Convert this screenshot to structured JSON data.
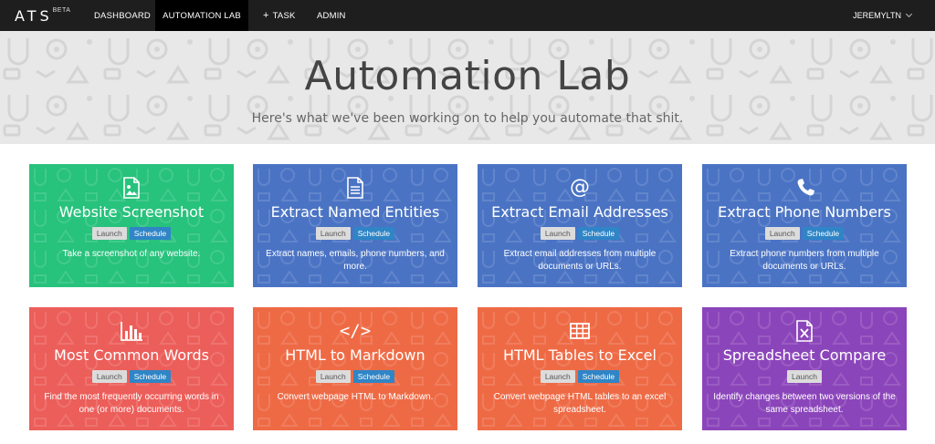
{
  "nav": {
    "brand": "ATS",
    "brand_sup": "BETA",
    "items": [
      {
        "label": "DASHBOARD",
        "active": false
      },
      {
        "label": "AUTOMATION LAB",
        "active": true
      },
      {
        "label": "TASK",
        "active": false
      },
      {
        "label": "ADMIN",
        "active": false
      }
    ],
    "task_plus": "+",
    "user": "JEREMYLTN"
  },
  "hero": {
    "title": "Automation Lab",
    "subtitle": "Here's what we've been working on to help you automate that shit."
  },
  "buttons": {
    "launch": "Launch",
    "schedule": "Schedule"
  },
  "cards": [
    {
      "title": "Website Screenshot",
      "desc": "Take a screenshot of any website.",
      "icon": "image-icon",
      "color": "#27c27c",
      "schedule": true
    },
    {
      "title": "Extract Named Entities",
      "desc": "Extract names, emails, phone numbers, and more.",
      "icon": "document-icon",
      "color": "#4a73c4",
      "schedule": true
    },
    {
      "title": "Extract Email Addresses",
      "desc": "Extract email addresses from multiple documents or URLs.",
      "icon": "at-icon",
      "color": "#4a73c4",
      "schedule": true
    },
    {
      "title": "Extract Phone Numbers",
      "desc": "Extract phone numbers from multiple documents or URLs.",
      "icon": "phone-icon",
      "color": "#4a73c4",
      "schedule": true
    },
    {
      "title": "Most Common Words",
      "desc": "Find the most frequently occurring words in one (or more) documents.",
      "icon": "bar-chart-icon",
      "color": "#ec5e5a",
      "schedule": true
    },
    {
      "title": "HTML to Markdown",
      "desc": "Convert webpage HTML to Markdown.",
      "icon": "code-icon",
      "color": "#ee6a45",
      "schedule": true
    },
    {
      "title": "HTML Tables to Excel",
      "desc": "Convert webpage HTML tables to an excel spreadsheet.",
      "icon": "table-icon",
      "color": "#ee6a45",
      "schedule": true
    },
    {
      "title": "Spreadsheet Compare",
      "desc": "Identify changes between two versions of the same spreadsheet.",
      "icon": "excel-file-icon",
      "color": "#8b45ba",
      "schedule": false
    }
  ],
  "icon_glyphs": {
    "at-icon": "@",
    "code-icon": "</>"
  }
}
